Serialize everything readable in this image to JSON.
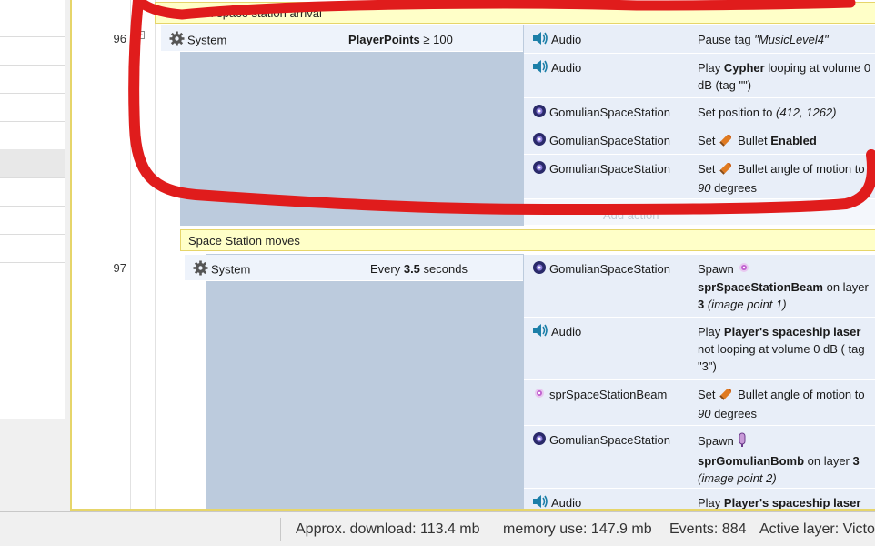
{
  "colors": {
    "highlight_stroke": "#e01c1c",
    "group_bg": "#ffffc8",
    "event_fill": "#bccbdd",
    "cell_bg": "#e8eef8"
  },
  "events": {
    "event96": {
      "group_title": "Gomulian space station arrival",
      "number": "96",
      "condition": {
        "object": "System",
        "value_name": "PlayerPoints",
        "value_rest": " ≥ 100"
      },
      "actions": [
        {
          "object": "Audio",
          "icon": "speaker-icon",
          "desc": {
            "a": "Pause tag ",
            "b": "\"MusicLevel4\""
          }
        },
        {
          "object": "Audio",
          "icon": "speaker-icon",
          "desc": {
            "a": "Play ",
            "b": "Cypher",
            "c": " looping at volume 0 dB (tag \"\")"
          }
        },
        {
          "object": "GomulianSpaceStation",
          "icon": "space-station-icon",
          "desc": {
            "a": "Set position to ",
            "b": "(412, 1262)"
          }
        },
        {
          "object": "GomulianSpaceStation",
          "icon": "space-station-icon",
          "desc": {
            "a": "Set ",
            "b": "Bullet ",
            "c": "Enabled"
          }
        },
        {
          "object": "GomulianSpaceStation",
          "icon": "space-station-icon",
          "desc": {
            "a": "Set ",
            "b": "Bullet angle of motion to ",
            "c": "90",
            "d": " degrees"
          }
        }
      ],
      "add_action": "Add action"
    },
    "event97": {
      "group_title": "Space Station moves",
      "number": "97",
      "condition": {
        "object": "System",
        "value_a": "Every ",
        "value_b": "3.5",
        "value_c": " seconds"
      },
      "actions": [
        {
          "object": "GomulianSpaceStation",
          "icon": "space-station-icon",
          "desc": {
            "a": "Spawn ",
            "b": "sprSpaceStationBeam",
            "c": " on layer ",
            "d": "3",
            "e": " (image point 1)"
          }
        },
        {
          "object": "Audio",
          "icon": "speaker-icon",
          "desc": {
            "a": "Play ",
            "b": "Player's spaceship laser",
            "c": " not looping at volume 0 dB ( tag \"3\")"
          }
        },
        {
          "object": "sprSpaceStationBeam",
          "icon": "beam-icon",
          "desc": {
            "a": "Set ",
            "b": "Bullet angle of motion to ",
            "c": "90",
            "d": " degrees"
          }
        },
        {
          "object": "GomulianSpaceStation",
          "icon": "space-station-icon",
          "desc": {
            "a": "Spawn ",
            "b": "sprGomulianBomb",
            "c": " on layer ",
            "d": "3",
            "e": " (image point 2)"
          }
        },
        {
          "object": "Audio",
          "icon": "speaker-icon",
          "desc": {
            "a": "Play ",
            "b": "Player's spaceship laser"
          }
        }
      ]
    }
  },
  "statusbar": {
    "download": "Approx. download: 113.4 mb",
    "memory": "memory use: 147.9 mb",
    "events": "Events: 884",
    "layer": "Active layer: Victo"
  }
}
